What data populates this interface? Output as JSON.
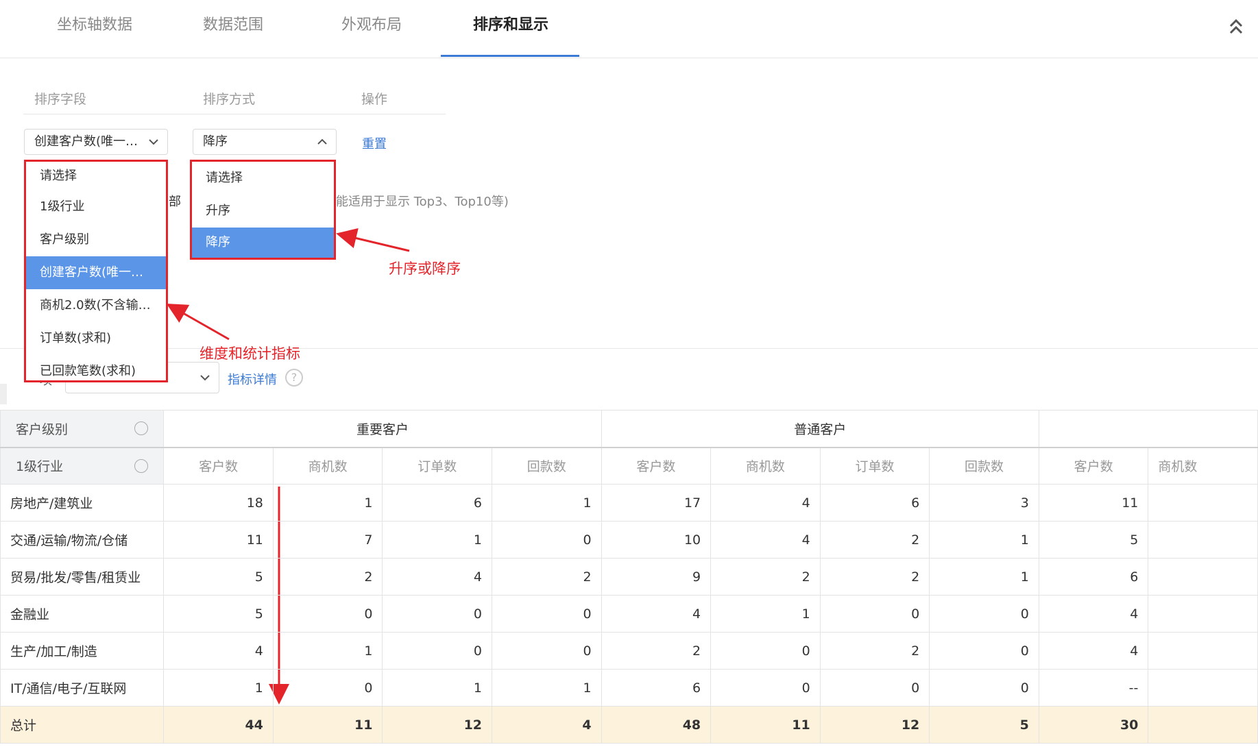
{
  "tabs": [
    {
      "label": "坐标轴数据",
      "active": false
    },
    {
      "label": "数据范围",
      "active": false
    },
    {
      "label": "外观布局",
      "active": false
    },
    {
      "label": "排序和显示",
      "active": true
    }
  ],
  "sort": {
    "headers": {
      "field": "排序字段",
      "method": "排序方式",
      "action": "操作"
    },
    "field_value": "创建客户数(唯一…",
    "method_value": "降序",
    "reset_label": "重置"
  },
  "background": {
    "partial_text": "部",
    "hint_text": "能适用于显示 Top3、Top10等)",
    "metric_detail_link": "指标详情",
    "filter_label": "项"
  },
  "field_dropdown": {
    "items": [
      "请选择",
      "1级行业",
      "客户级别",
      "创建客户数(唯一…",
      "商机2.0数(不含输…",
      "订单数(求和)",
      "已回款笔数(求和)"
    ],
    "selected_index": 3
  },
  "method_dropdown": {
    "items": [
      "请选择",
      "升序",
      "降序"
    ],
    "selected_index": 2
  },
  "annotations": {
    "method": "升序或降序",
    "field": "维度和统计指标"
  },
  "colors": {
    "accent": "#3b7bd6",
    "annotation": "#e4242b",
    "selected": "#5b95e8",
    "total_row": "#fdf3dd"
  },
  "table": {
    "dim1_label": "客户级别",
    "dim2_label": "1级行业",
    "groups": [
      "重要客户",
      "普通客户",
      ""
    ],
    "metrics": [
      "客户数",
      "商机数",
      "订单数",
      "回款数",
      "客户数",
      "商机数",
      "订单数",
      "回款数",
      "客户数",
      "商机数"
    ],
    "rows": [
      {
        "label": "房地产/建筑业",
        "values": [
          "18",
          "1",
          "6",
          "1",
          "17",
          "4",
          "6",
          "3",
          "11",
          ""
        ]
      },
      {
        "label": "交通/运输/物流/仓储",
        "values": [
          "11",
          "7",
          "1",
          "0",
          "10",
          "4",
          "2",
          "1",
          "5",
          ""
        ]
      },
      {
        "label": "贸易/批发/零售/租赁业",
        "values": [
          "5",
          "2",
          "4",
          "2",
          "9",
          "2",
          "2",
          "1",
          "6",
          ""
        ]
      },
      {
        "label": "金融业",
        "values": [
          "5",
          "0",
          "0",
          "0",
          "4",
          "1",
          "0",
          "0",
          "4",
          ""
        ]
      },
      {
        "label": "生产/加工/制造",
        "values": [
          "4",
          "1",
          "0",
          "0",
          "2",
          "0",
          "2",
          "0",
          "4",
          ""
        ]
      },
      {
        "label": "IT/通信/电子/互联网",
        "values": [
          "1",
          "0",
          "1",
          "1",
          "6",
          "0",
          "0",
          "0",
          "--",
          ""
        ]
      }
    ],
    "total": {
      "label": "总计",
      "values": [
        "44",
        "11",
        "12",
        "4",
        "48",
        "11",
        "12",
        "5",
        "30",
        ""
      ]
    }
  }
}
